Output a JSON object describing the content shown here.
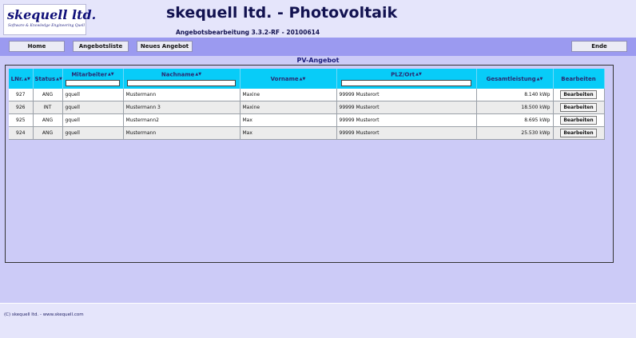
{
  "logo": {
    "name": "skequell ltd.",
    "tagline": "Software & Knowledge Engineering Quell"
  },
  "header": {
    "title": "skequell ltd. - Photovoltaik",
    "version": "Angebotsbearbeitung 3.3.2-RF - 20100614"
  },
  "nav": {
    "home": "Home",
    "list": "Angebotsliste",
    "new": "Neues Angebot",
    "exit": "Ende"
  },
  "section_title": "PV-Angebot",
  "table": {
    "columns": {
      "lfnr": "LNr.",
      "status": "Status",
      "mitarbeiter": "Mitarbeiter",
      "nachname": "Nachname",
      "vorname": "Vorname",
      "plzort": "PLZ/Ort",
      "leistung": "Gesamtleistung",
      "bearbeiten": "Bearbeiten"
    },
    "rows": [
      {
        "nr": "927",
        "status": "ANG",
        "mitarbeiter": "gquell",
        "nachname": "Mustermann",
        "vorname": "Maxine",
        "plzort": "99999 Musterort",
        "leistung": "8.140 kWp",
        "action": "Bearbeiten"
      },
      {
        "nr": "926",
        "status": "INT",
        "mitarbeiter": "gquell",
        "nachname": "Mustermann 3",
        "vorname": "Maxine",
        "plzort": "99999 Musterort",
        "leistung": "18.500 kWp",
        "action": "Bearbeiten"
      },
      {
        "nr": "925",
        "status": "ANG",
        "mitarbeiter": "gquell",
        "nachname": "Mustermann2",
        "vorname": "Max",
        "plzort": "99999 Musterort",
        "leistung": "8.695 kWp",
        "action": "Bearbeiten"
      },
      {
        "nr": "924",
        "status": "ANG",
        "mitarbeiter": "gquell",
        "nachname": "Mustermann",
        "vorname": "Max",
        "plzort": "99999 Musterort",
        "leistung": "25.530 kWp",
        "action": "Bearbeiten"
      }
    ]
  },
  "footer": {
    "text": "(C) skequell ltd. - www.skequell.com"
  }
}
